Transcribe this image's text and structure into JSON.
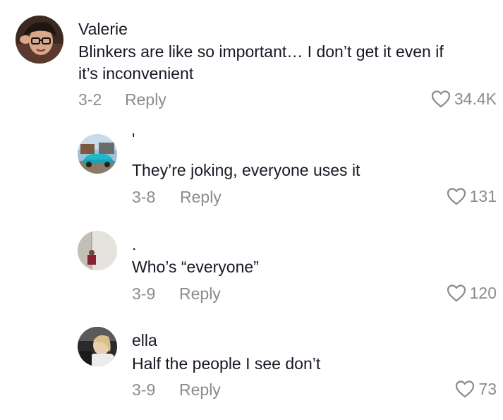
{
  "comments": [
    {
      "username": "Valerie",
      "text_line1": "Blinkers are like so important… I don’t get it even if",
      "text_line2": "it’s inconvenient",
      "date": "3-2",
      "reply_label": "Reply",
      "likes": "34.4K"
    },
    {
      "username": "'",
      "text": "They’re joking, everyone uses it",
      "date": "3-8",
      "reply_label": "Reply",
      "likes": "131"
    },
    {
      "username": ".",
      "text": "Who’s “everyone”",
      "date": "3-9",
      "reply_label": "Reply",
      "likes": "120"
    },
    {
      "username": "ella",
      "text": "Half the people I see don’t",
      "date": "3-9",
      "reply_label": "Reply",
      "likes": "73"
    }
  ],
  "icons": {
    "like": "heart-outline-icon"
  },
  "colors": {
    "primary_text": "#161823",
    "secondary_text": "#8a8b91"
  }
}
